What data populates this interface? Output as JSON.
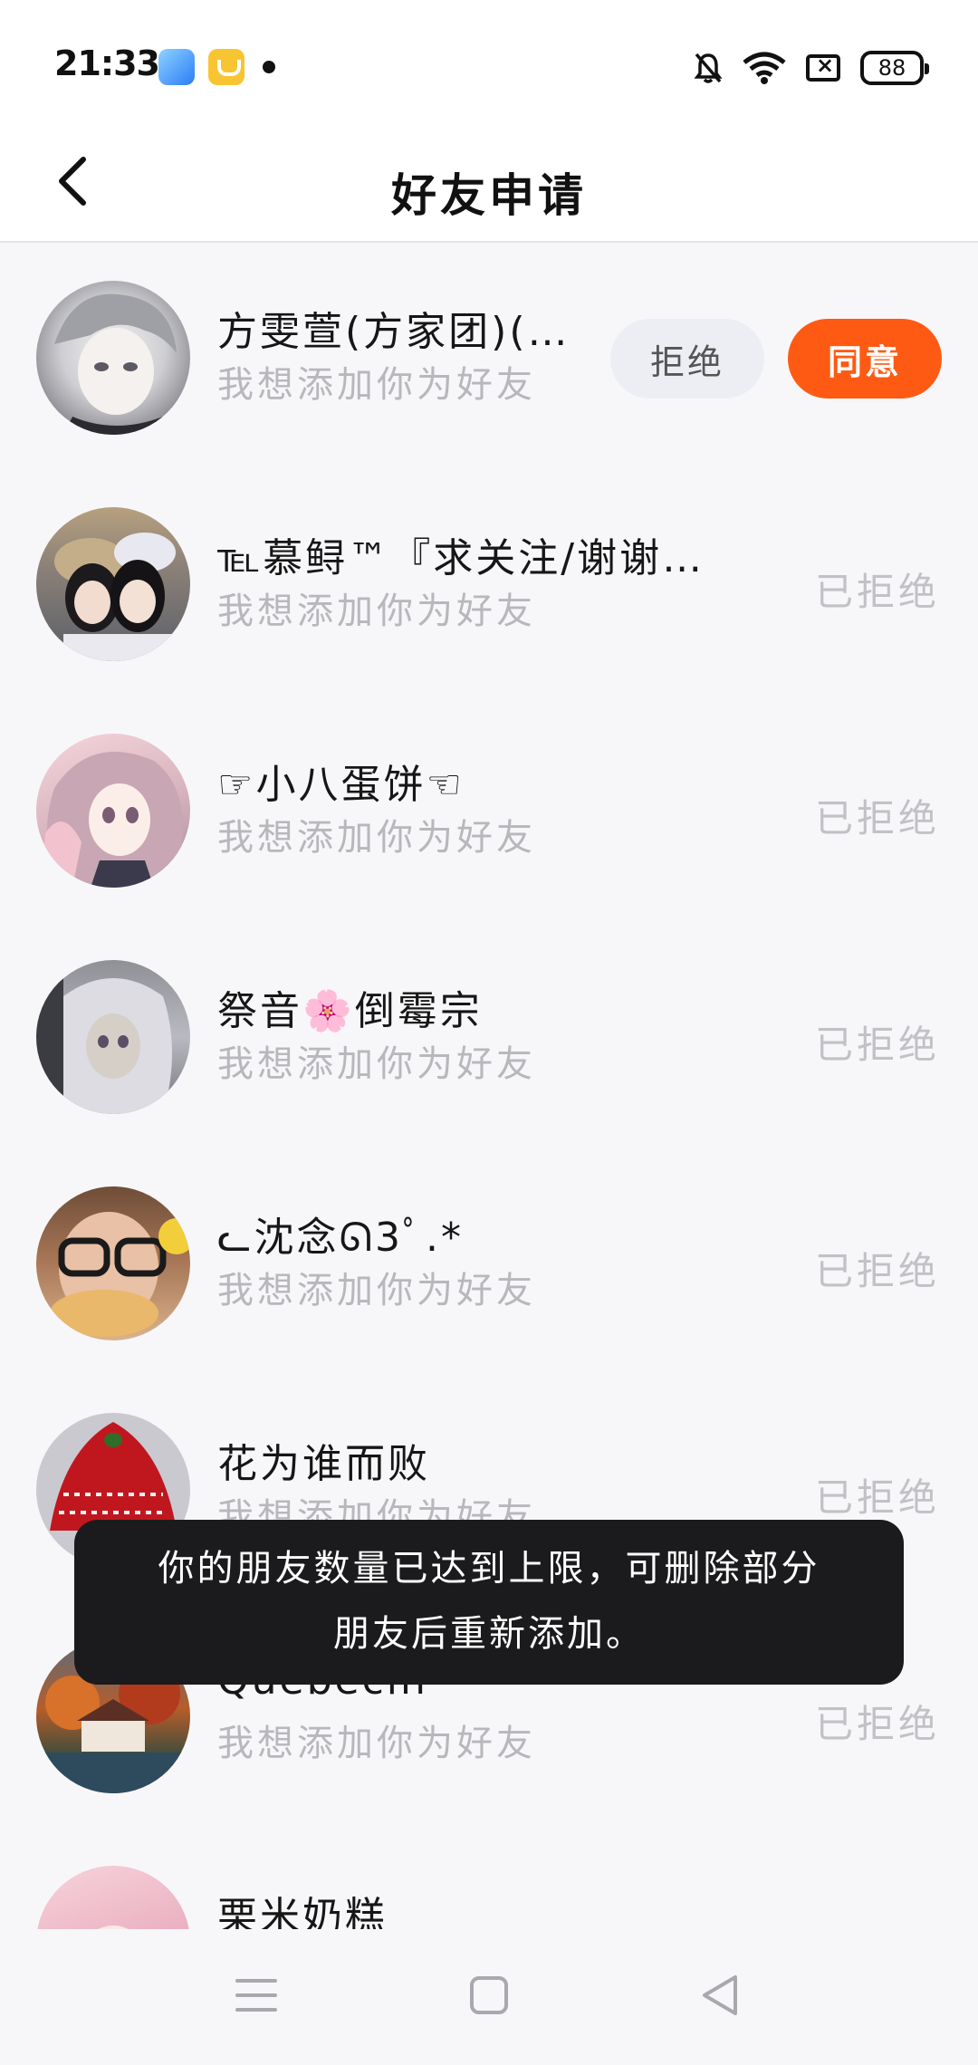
{
  "status_bar": {
    "time": "21:33",
    "battery": "88",
    "icons": [
      "blue-app-icon",
      "yellow-app-icon",
      "notification-dot",
      "bell-off-icon",
      "wifi-icon",
      "sim-off-icon",
      "battery-icon"
    ]
  },
  "header": {
    "title": "好友申请",
    "back_icon": "chevron-left-icon"
  },
  "requests": [
    {
      "name": "方雯萱(方家团)(…",
      "message": "我想添加你为好友",
      "status": "pending",
      "reject_label": "拒绝",
      "agree_label": "同意"
    },
    {
      "name": "℡慕鲟™『求关注/谢谢…",
      "message": "我想添加你为好友",
      "status": "已拒绝"
    },
    {
      "name": "☞小八蛋饼☜",
      "message": "我想添加你为好友",
      "status": "已拒绝"
    },
    {
      "name": "祭音🌸倒霉宗",
      "message": "我想添加你为好友",
      "status": "已拒绝"
    },
    {
      "name": "ᓚ沈念ᘏ3ﾟ.*",
      "message": "我想添加你为好友",
      "status": "已拒绝"
    },
    {
      "name": "花为谁而败",
      "message": "我想添加你为好友",
      "status": "已拒绝"
    },
    {
      "name": "Quebecin",
      "message": "我想添加你为好友",
      "status": "已拒绝"
    },
    {
      "name": "栗米奶糕",
      "message": "",
      "status": ""
    }
  ],
  "toast": {
    "line1": "你的朋友数量已达到上限，可删除部分",
    "line2": "朋友后重新添加。"
  },
  "nav_bar": {
    "icons": [
      "menu-icon",
      "home-square-icon",
      "back-triangle-icon"
    ]
  }
}
